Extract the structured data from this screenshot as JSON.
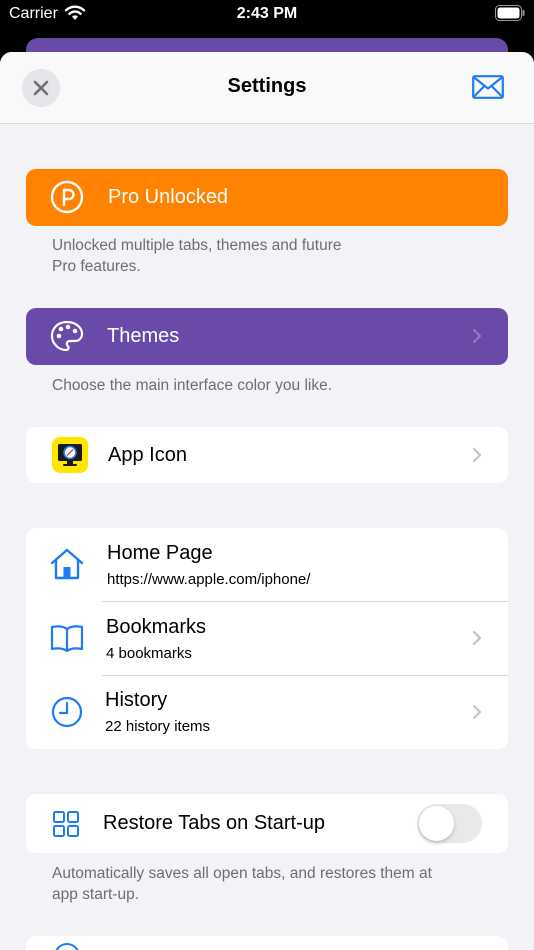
{
  "status_bar": {
    "carrier": "Carrier",
    "time": "2:43 PM"
  },
  "nav": {
    "title": "Settings"
  },
  "pro": {
    "label": "Pro Unlocked",
    "footnote_line1": "Unlocked multiple tabs, themes and future",
    "footnote_line2": "Pro features.",
    "color": "#ff8200"
  },
  "themes": {
    "label": "Themes",
    "footnote": "Choose the main interface color you like.",
    "color": "#6a4aa8"
  },
  "app_icon": {
    "label": "App Icon"
  },
  "navigation_group": {
    "home": {
      "title": "Home Page",
      "subtitle": "https://www.apple.com/iphone/"
    },
    "bookmarks": {
      "title": "Bookmarks",
      "subtitle": "4 bookmarks"
    },
    "history": {
      "title": "History",
      "subtitle": "22 history items"
    }
  },
  "restore_tabs": {
    "label": "Restore Tabs on Start-up",
    "enabled": false,
    "footnote_line1": "Automatically saves all open tabs, and restores them at",
    "footnote_line2": "app start-up."
  },
  "colors": {
    "accent_blue": "#1e7cf2",
    "background": "#f2f2f7"
  }
}
